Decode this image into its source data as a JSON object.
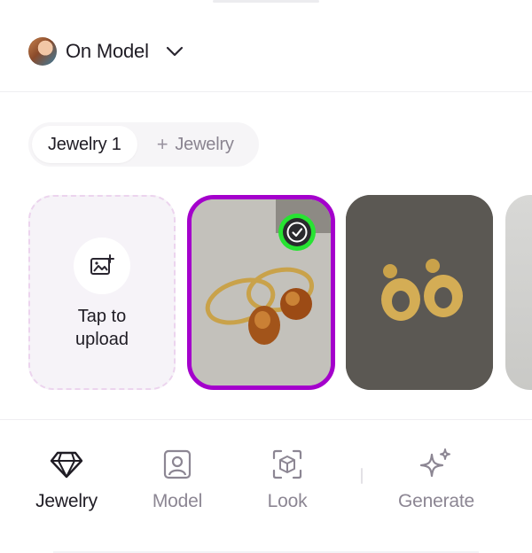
{
  "header": {
    "mode_label": "On Model",
    "avatar_icon": "user-avatar",
    "chevron_icon": "chevron-down-icon"
  },
  "jewelry_tabs": {
    "items": [
      {
        "label": "Jewelry 1",
        "active": true
      },
      {
        "label": "Jewelry",
        "active": false,
        "prefix": "+"
      }
    ]
  },
  "images": {
    "upload_label": "Tap to upload",
    "upload_icon": "image-add-icon",
    "selected_index": 1,
    "thumbnails": [
      {
        "alt": "amber drop hoop earrings",
        "selected": true
      },
      {
        "alt": "gold door-knocker earrings",
        "selected": false
      },
      {
        "alt": "partial image",
        "selected": false
      }
    ],
    "selected_badge_icon": "check-circle-icon"
  },
  "bottom_nav": {
    "items": [
      {
        "label": "Jewelry",
        "icon": "diamond-icon",
        "active": true
      },
      {
        "label": "Model",
        "icon": "portrait-icon",
        "active": false
      },
      {
        "label": "Look",
        "icon": "scan-cube-icon",
        "active": false
      },
      {
        "label": "Generate",
        "icon": "sparkles-icon",
        "active": false
      }
    ]
  },
  "colors": {
    "accent": "#a400cc",
    "badge_ring": "#27e332",
    "text_primary": "#1f1c24",
    "text_muted": "#8c8693",
    "upload_border": "#ecd4ee",
    "upload_bg": "#f6f3f8"
  }
}
